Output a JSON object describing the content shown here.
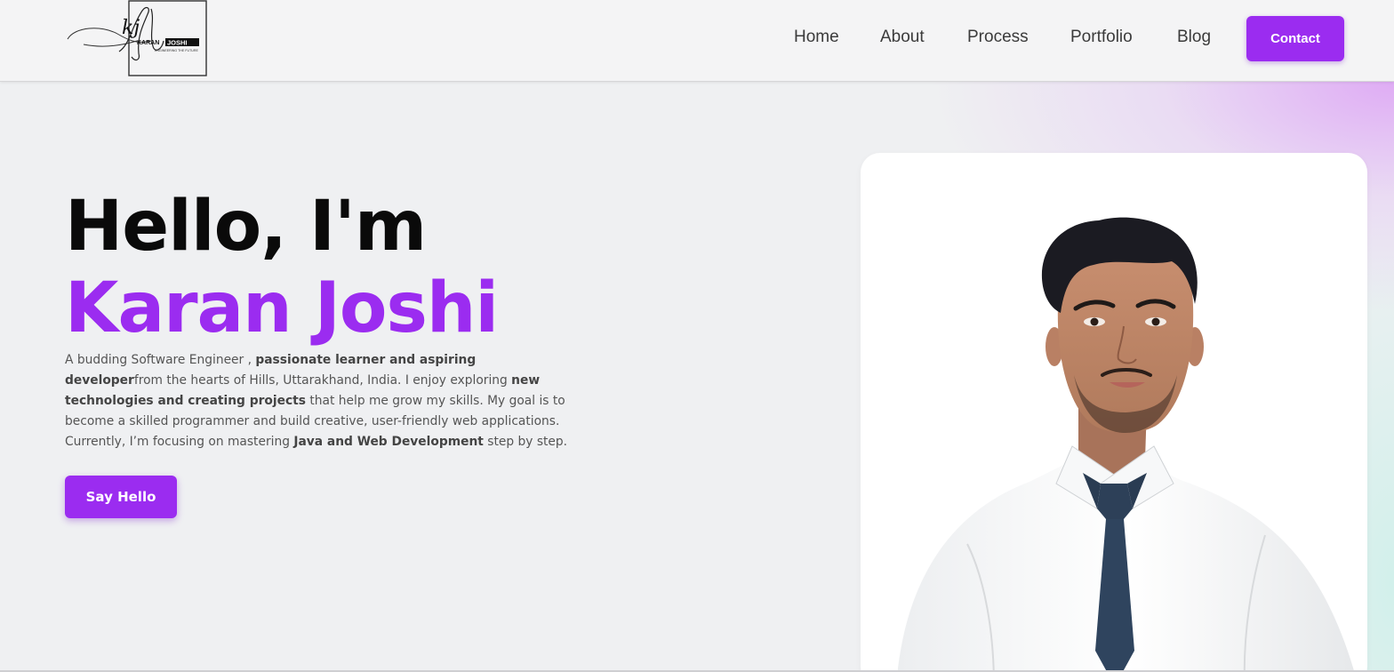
{
  "logo": {
    "initials": "kj",
    "brand_first": "KARAN",
    "brand_last": "JOSHI",
    "tagline": "ENGINEERING THE FUTURE"
  },
  "nav": {
    "items": [
      {
        "label": "Home"
      },
      {
        "label": "About"
      },
      {
        "label": "Process"
      },
      {
        "label": "Portfolio"
      },
      {
        "label": "Blog"
      }
    ],
    "contact_label": "Contact"
  },
  "hero": {
    "greeting": "Hello, I'm",
    "name": "Karan Joshi",
    "desc": {
      "p1": "A budding Software Engineer , ",
      "b1": "passionate learner and aspiring developer",
      "p2": "from the hearts of Hills, Uttarakhand, India. I enjoy exploring ",
      "b2": "new technologies and creating projects",
      "p3": " that help me grow my skills. My goal is to become a skilled programmer and build creative, user-friendly web applications. Currently, I’m focusing on mastering ",
      "b3": "Java and Web Development",
      "p4": " step by step."
    },
    "cta_label": "Say Hello"
  },
  "colors": {
    "accent": "#9b2cf0",
    "heading": "#0a0a0a",
    "body_text": "#555555",
    "background": "#eff0f2"
  },
  "icons": {
    "logo": "signature-logo",
    "portrait": "profile-portrait"
  }
}
